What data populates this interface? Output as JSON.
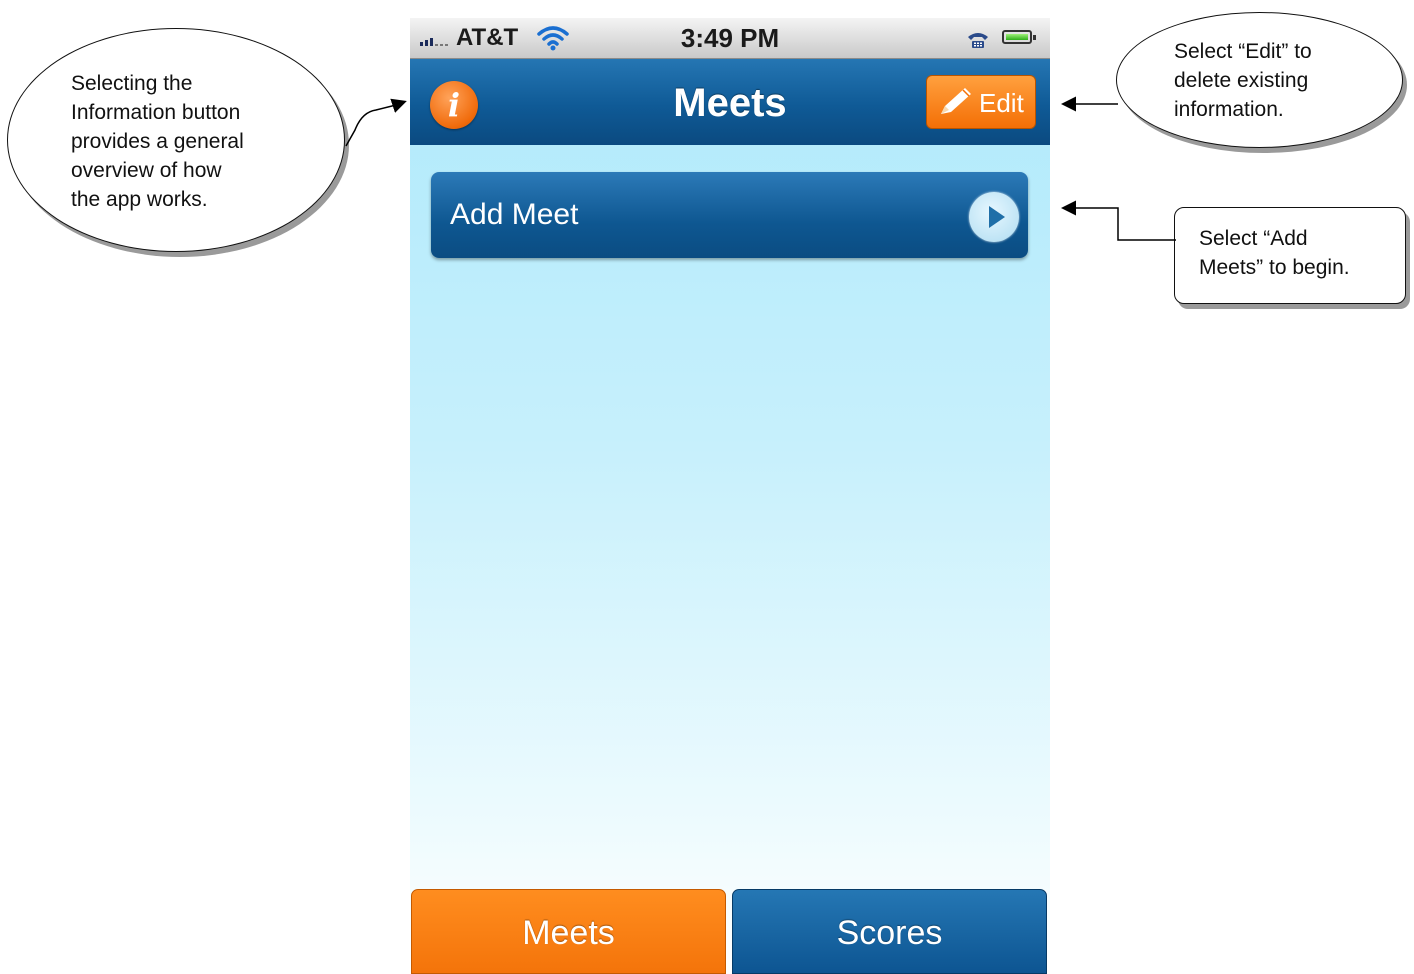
{
  "status_bar": {
    "carrier": "AT&T",
    "time": "3:49 PM"
  },
  "nav_bar": {
    "title": "Meets",
    "info_button_glyph": "i",
    "edit_label": "Edit"
  },
  "list": {
    "add_meet_label": "Add Meet"
  },
  "tab_bar": {
    "tabs": [
      {
        "label": "Meets",
        "selected": true
      },
      {
        "label": "Scores",
        "selected": false
      }
    ]
  },
  "callouts": {
    "info": "Selecting the\nInformation button\nprovides a general\noverview of how\nthe app works.",
    "edit": "Select “Edit” to\ndelete existing\ninformation.",
    "add": "Select “Add\nMeets” to begin."
  },
  "colors": {
    "nav_blue": "#0f5a96",
    "accent_orange": "#f4740a",
    "background_cyan": "#aee9fb"
  },
  "icons": [
    "signal-icon",
    "wifi-icon",
    "phone-icon",
    "battery-icon",
    "info-icon",
    "pencil-icon",
    "play-arrow-icon"
  ]
}
